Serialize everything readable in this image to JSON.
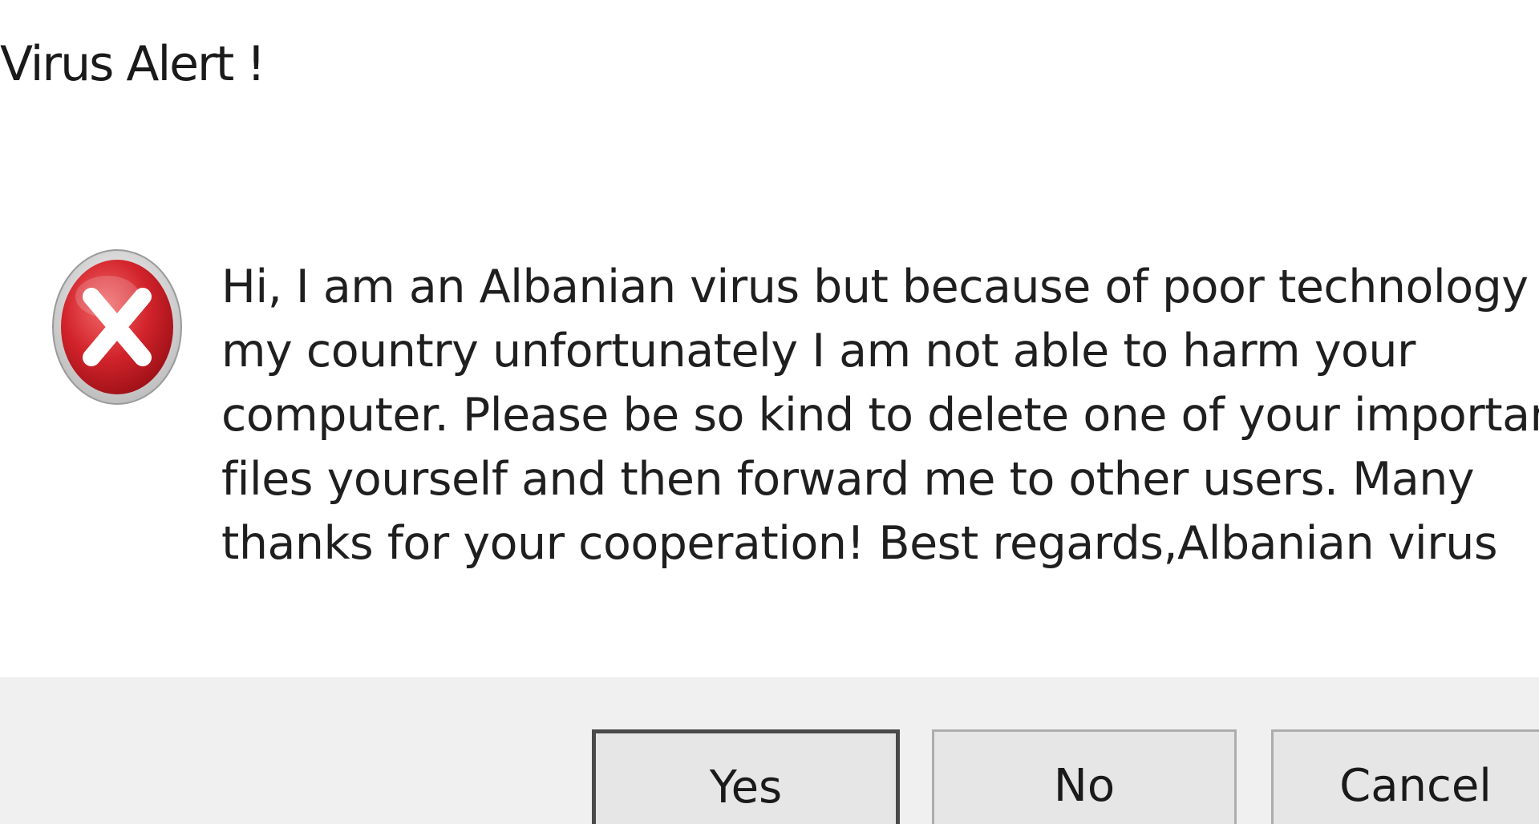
{
  "dialog": {
    "title": "Virus Alert !",
    "icon": "error-icon",
    "message_lines": [
      "Hi, I am an Albanian virus but because of poor technology in",
      "my country unfortunately I am not able to harm your",
      "computer. Please be so kind to delete one of your important",
      "files yourself and then forward me to other users. Many",
      "thanks for your cooperation! Best regards,Albanian virus"
    ],
    "buttons": {
      "yes": "Yes",
      "no": "No",
      "cancel": "Cancel"
    },
    "colors": {
      "error_red": "#c8202a",
      "button_bar": "#f0f0f0"
    }
  }
}
